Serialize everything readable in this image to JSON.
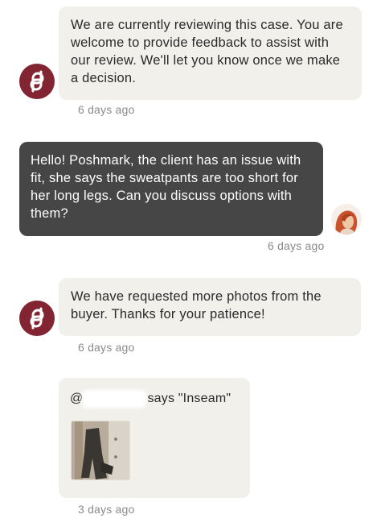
{
  "messages": [
    {
      "sender": "Poshmark",
      "text": "We are currently reviewing this case. You are welcome to provide feedback to assist with our review. We'll let you know once we make a decision.",
      "time": "6 days ago"
    },
    {
      "sender": "user",
      "text": "Hello! Poshmark, the client has an issue with fit, she says the sweatpants are too short for her long legs. Can you discuss options with them?",
      "time": "6 days ago"
    },
    {
      "sender": "Poshmark",
      "text": "We have requested more photos from the buyer. Thanks for your patience!",
      "time": "6 days ago"
    },
    {
      "sender": "buyer",
      "mention_prefix": "@",
      "text": "says \"Inseam\"",
      "time": "3 days ago"
    }
  ],
  "icons": {
    "poshmark_avatar": "poshmark-logo-icon",
    "user_avatar": "user-avatar",
    "attachment": "attachment-photo"
  },
  "colors": {
    "poshmark_brand": "#822432",
    "incoming_bubble": "#f2f0eb",
    "outgoing_bubble": "#464646",
    "timestamp": "#8a8a8a"
  }
}
